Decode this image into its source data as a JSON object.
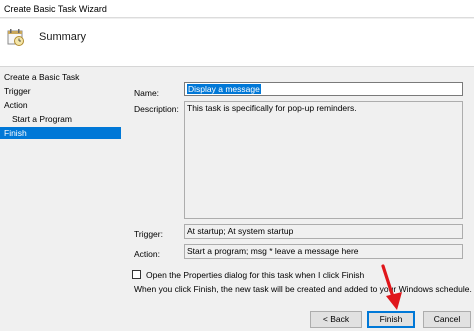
{
  "window": {
    "title": "Create Basic Task Wizard"
  },
  "header": {
    "icon": "task-clock-icon",
    "heading": "Summary"
  },
  "nav": {
    "items": [
      {
        "label": "Create a Basic Task",
        "selected": false
      },
      {
        "label": "Trigger",
        "selected": false
      },
      {
        "label": "Action",
        "selected": false
      },
      {
        "label": "Start a Program",
        "selected": false
      },
      {
        "label": "Finish",
        "selected": true
      }
    ]
  },
  "summary": {
    "name_label": "Name:",
    "name_value": "Display a message",
    "description_label": "Description:",
    "description_value": "This task is specifically for pop-up reminders.",
    "trigger_label": "Trigger:",
    "trigger_value": "At startup; At system startup",
    "action_label": "Action:",
    "action_value": "Start a program; msg * leave a message here"
  },
  "options": {
    "open_properties_label": "Open the Properties dialog for this task when I click Finish",
    "open_properties_checked": false,
    "info_text": "When you click Finish, the new task will be created and added to your Windows schedule."
  },
  "buttons": {
    "back_label": "< Back",
    "finish_label": "Finish",
    "cancel_label": "Cancel"
  },
  "colors": {
    "selection": "#0078d7",
    "annotation_arrow": "#e0161b"
  }
}
